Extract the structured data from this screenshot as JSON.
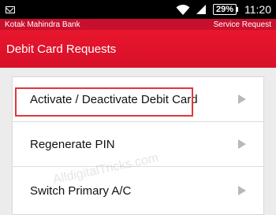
{
  "status_bar": {
    "battery": "29%",
    "time": "11:20",
    "icons": [
      "mail-icon",
      "wifi-icon",
      "signal-icon",
      "battery-icon"
    ]
  },
  "app_bar": {
    "bank_name": "Kotak Mahindra Bank",
    "section": "Service Request"
  },
  "header": {
    "title": "Debit Card Requests"
  },
  "menu": {
    "items": [
      {
        "label": "Activate / Deactivate Debit Card",
        "highlighted": true
      },
      {
        "label": "Regenerate PIN"
      },
      {
        "label": "Switch Primary A/C"
      }
    ]
  },
  "watermark": "AlldigitalTricks.com",
  "colors": {
    "header_red": "#e8162c",
    "highlight_border": "#e2363b",
    "chevron": "#b8b8b8",
    "background": "#ececec"
  }
}
